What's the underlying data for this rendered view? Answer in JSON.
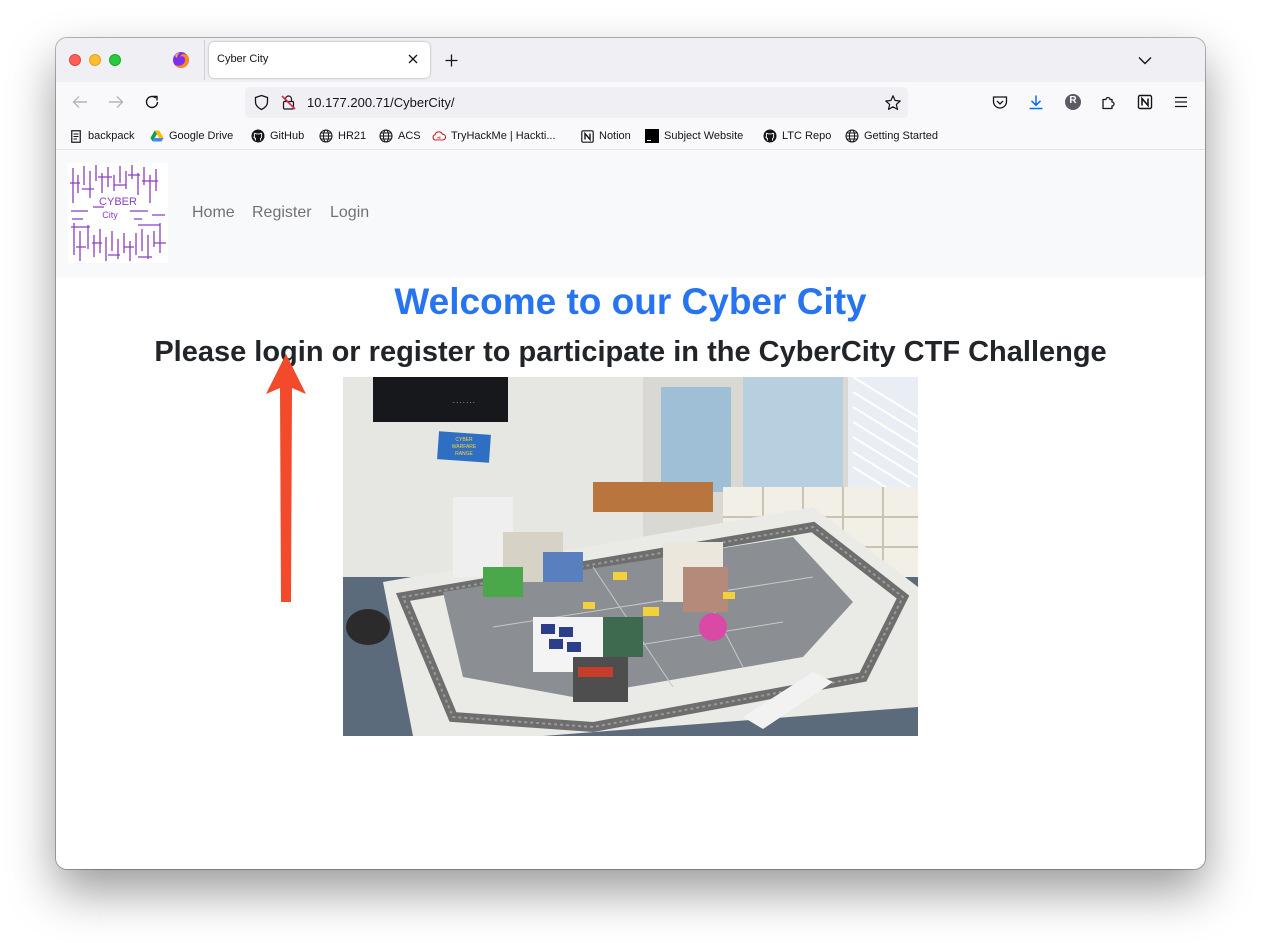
{
  "browser": {
    "tab": {
      "title": "Cyber City"
    },
    "url": "10.177.200.71/CyberCity/",
    "profile_initial": "R",
    "bookmarks": [
      {
        "label": "backpack",
        "icon": "page-icon"
      },
      {
        "label": "Google Drive",
        "icon": "google-drive-icon"
      },
      {
        "label": "GitHub",
        "icon": "github-icon"
      },
      {
        "label": "HR21",
        "icon": "globe-icon"
      },
      {
        "label": "ACS",
        "icon": "globe-icon"
      },
      {
        "label": "TryHackMe | Hackti...",
        "icon": "tryhackme-icon"
      },
      {
        "label": "Notion",
        "icon": "notion-icon"
      },
      {
        "label": "Subject Website",
        "icon": "terminal-icon"
      },
      {
        "label": "LTC Repo",
        "icon": "github-icon"
      },
      {
        "label": "Getting Started",
        "icon": "globe-icon"
      }
    ]
  },
  "site": {
    "logo": {
      "line1": "CYBER",
      "line2": "City"
    },
    "nav": [
      {
        "label": "Home"
      },
      {
        "label": "Register"
      },
      {
        "label": "Login"
      }
    ],
    "heading": "Welcome to our Cyber City",
    "subheading": "Please login or register to participate in the CyberCity CTF Challenge",
    "photo_sign": {
      "line1": "CYBER",
      "line2": "WARFARE",
      "line3": "RANGE"
    }
  },
  "colors": {
    "heading": "#2774f0",
    "arrow": "#f24a2a",
    "logo_purple": "#9b4dca"
  }
}
